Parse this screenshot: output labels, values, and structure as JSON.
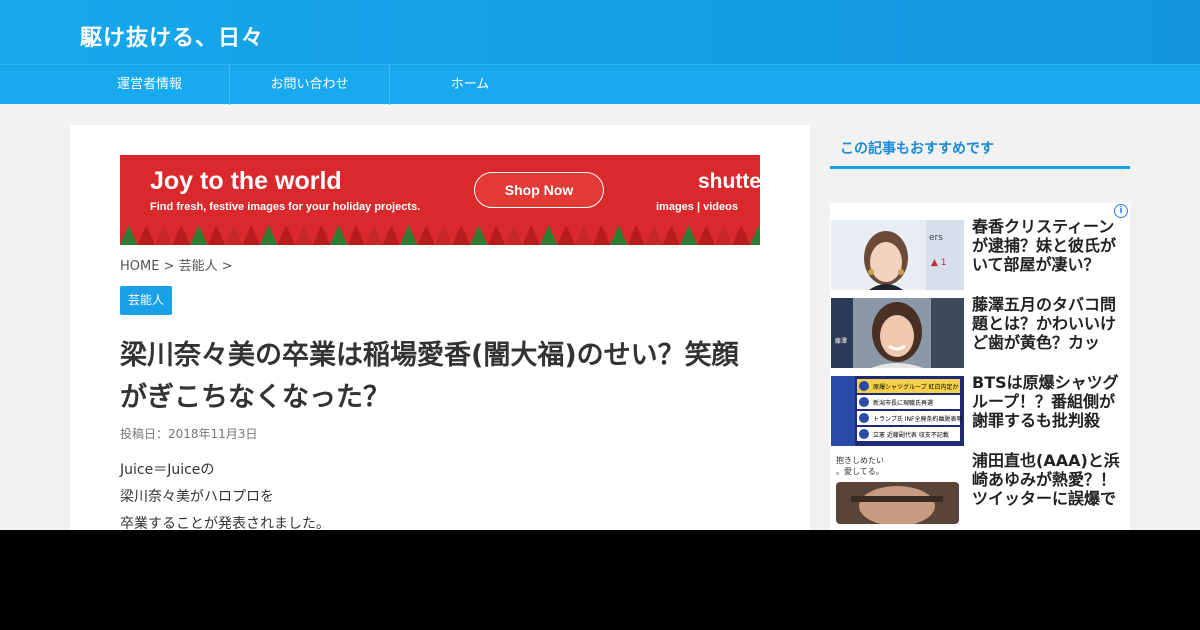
{
  "site": {
    "title": "駆け抜ける、日々"
  },
  "nav": {
    "items": [
      "運営者情報",
      "お問い合わせ",
      "ホーム"
    ]
  },
  "ad": {
    "headline": "Joy to the world",
    "subline": "Find fresh, festive images for your holiday projects.",
    "button": "Shop Now",
    "brand": "shutter",
    "links": "images   |   videos"
  },
  "breadcrumb": {
    "home": "HOME",
    "sep": ">",
    "category": "芸能人"
  },
  "post": {
    "category": "芸能人",
    "title": "梁川奈々美の卒業は稲場愛香(闇大福)のせい？笑顔がぎこちなくなった？",
    "date": "投稿日：2018年11月3日",
    "lines": [
      "Juice＝Juiceの",
      "梁川奈々美がハロプロを",
      "卒業することが発表されました。"
    ]
  },
  "sidebar": {
    "heading": "この記事もおすすめです",
    "ad_info_icon": "i",
    "items": [
      {
        "title": "春香クリスティーンが逮捕？妹と彼氏がいて部屋が凄い？引…",
        "thumb": "woman-portrait"
      },
      {
        "title": "藤澤五月のタバコ問題とは？かわいいけど歯が黄色？カップ…",
        "thumb": "woman-smiling"
      },
      {
        "title": "BTSは原爆シャツグループ！？番組側が謝罪するも批判殺到…",
        "thumb": "news-ranking-screen"
      },
      {
        "title": "浦田直也(AAA)と浜崎あゆみが熱愛？！ツイッターに誤爆で発…",
        "thumb": "man-photo"
      }
    ],
    "thumb_texts": {
      "t3_rows": [
        "原爆シャツグループ 紅白内定か",
        "新潟市長に現職氏再選",
        "トランプ氏 INF全廃条約離脱表明",
        "立憲 近藤副代表 収支不記載"
      ],
      "t4_caption": "抱きしめたい\n。愛してる。"
    }
  },
  "colors": {
    "header": "#17a8ec",
    "accent": "#1aa0e6",
    "ad_red": "#d9292c"
  }
}
